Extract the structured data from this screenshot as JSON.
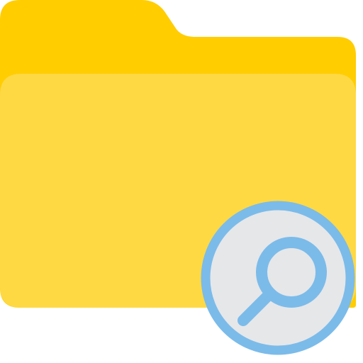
{
  "icon": {
    "name": "folder-search-icon",
    "colors": {
      "folder_back": "#FFCD00",
      "folder_front": "#FFD944",
      "badge_fill": "#E6E7E9",
      "badge_stroke": "#7BBBEA",
      "magnifier_stroke": "#7BBBEA",
      "background": "#FFFFFF"
    }
  }
}
